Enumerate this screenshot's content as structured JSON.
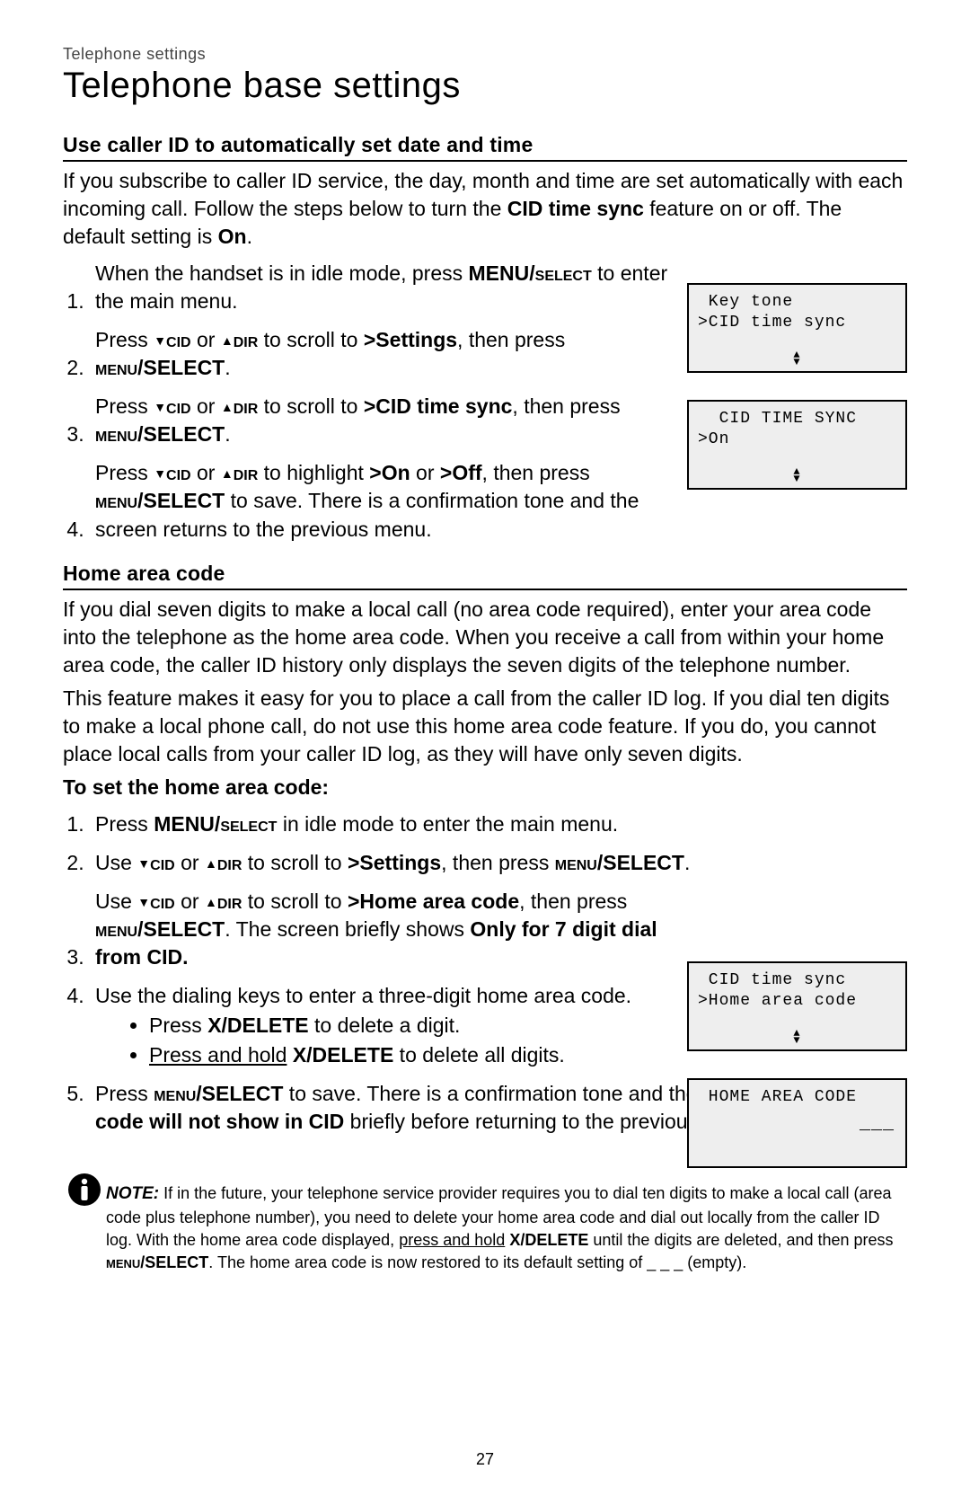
{
  "breadcrumb": "Telephone settings",
  "title": "Telephone base settings",
  "sec1_heading": "Use caller ID to automatically set date and time",
  "sec1_intro_a": "If you subscribe to caller ID service, the day, month and time are set automatically with each incoming call. Follow the steps below to turn the ",
  "sec1_intro_b": "CID time sync",
  "sec1_intro_c": " feature on or off. The default setting is ",
  "sec1_intro_d": "On",
  "sec1_intro_e": ".",
  "s1_step1_a": "When the handset is in idle mode, press ",
  "s1_step1_b": "MENU/",
  "s1_step1_c": "select",
  "s1_step1_d": " to enter the main menu.",
  "s1_step2_a": "Press ",
  "s1_step2_b": "cid",
  "s1_step2_c": " or ",
  "s1_step2_d": "dir",
  "s1_step2_e": " to scroll to ",
  "s1_step2_f": ">Settings",
  "s1_step2_g": ", then press ",
  "s1_step2_h": "menu",
  "s1_step2_i": "/SELECT",
  "s1_step2_j": ".",
  "s1_step3_a": "Press ",
  "s1_step3_e": " to scroll to ",
  "s1_step3_f": ">CID time sync",
  "s1_step3_g": ", then press ",
  "s1_step3_j": ".",
  "s1_step4_a": "Press ",
  "s1_step4_e": " to highlight ",
  "s1_step4_f": ">On",
  "s1_step4_g": " or ",
  "s1_step4_h": ">Off",
  "s1_step4_i": ", then press ",
  "s1_step4_l": " to save. There is a confirmation tone and the screen returns to the previous menu.",
  "sec2_heading": "Home area code",
  "sec2_p1": "If you dial seven digits to make a local call (no area code required), enter your area code into the telephone as the home area code. When you receive a call from within your home area code, the caller ID history only displays the seven digits of the telephone number.",
  "sec2_p2": "This feature makes it easy for you to place a call from the caller ID log. If you dial ten digits to make a local phone call, do not use this home area code feature. If you do, you cannot place local calls from your caller ID log, as they will have only seven digits.",
  "sec2_sub": "To set the home area code:",
  "s2_step1_a": "Press ",
  "s2_step1_d": " in idle mode to enter the main menu.",
  "s2_step2_a": "Use ",
  "s2_step2_e": " to scroll to ",
  "s2_step2_f": ">Settings",
  "s2_step2_g": ", then press ",
  "s2_step2_j": ".",
  "s2_step3_a": "Use ",
  "s2_step3_e": " to scroll to ",
  "s2_step3_f": ">Home area code",
  "s2_step3_g": ", then press ",
  "s2_step3_j": ". The screen briefly shows ",
  "s2_step3_k": "Only for 7 digit dial from CID.",
  "s2_step4": "Use the dialing keys to enter a three-digit home area code.",
  "s2_step4_b1_a": "Press ",
  "s2_step4_b1_b": "X/DELETE",
  "s2_step4_b1_c": " to delete a digit.",
  "s2_step4_b2_a": "Press and hold",
  "s2_step4_b2_b": " ",
  "s2_step4_b2_c": "X/DELETE",
  "s2_step4_b2_d": " to delete all digits.",
  "s2_step5_a": "Press ",
  "s2_step5_d": " to save. There is a confirmation tone and the screen shows ",
  "s2_step5_e": "Area code will not show in CID",
  "s2_step5_f": " briefly before returning to the previous menu.",
  "lcd1_l1": " Key tone",
  "lcd1_l2": ">CID time sync",
  "lcd2_l1": "  CID TIME SYNC",
  "lcd2_l2": ">On",
  "lcd3_l1": " CID time sync",
  "lcd3_l2": ">Home area code",
  "lcd4_l1": " HOME AREA CODE",
  "lcd4_dashes": "___",
  "note_label": "NOTE:",
  "note_a": " If in the future, your telephone service provider requires you to dial ten digits to make a local call (area code plus telephone number), you need to delete your home area code and dial out locally from the caller ID log. With the home area code displayed, ",
  "note_b": "press and hold",
  "note_c": " ",
  "note_d": "X/DELETE",
  "note_e": " until the digits are deleted, and then press ",
  "note_f": "menu",
  "note_g": "/SELECT",
  "note_h": ". The home area code is now restored to its default setting of _ _ _ (empty).",
  "pagenum": "27"
}
